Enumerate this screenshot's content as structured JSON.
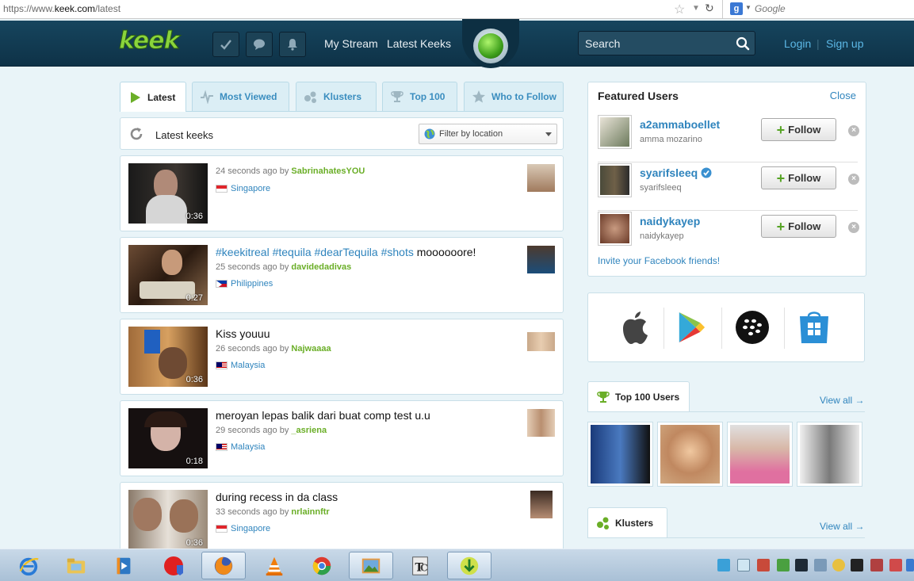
{
  "browser": {
    "url_prefix": "https://www.",
    "url_domain": "keek.com",
    "url_path": "/latest",
    "search_placeholder": "Google"
  },
  "header": {
    "logo": "keek",
    "nav": [
      "My Stream",
      "Latest Keeks"
    ],
    "search_placeholder": "Search",
    "login": "Login",
    "separator": "|",
    "signup": "Sign up"
  },
  "tabs": [
    {
      "label": "Latest",
      "icon": "play-icon",
      "active": true
    },
    {
      "label": "Most Viewed",
      "icon": "pulse-icon",
      "active": false
    },
    {
      "label": "Klusters",
      "icon": "klusters-icon",
      "active": false
    },
    {
      "label": "Top 100",
      "icon": "trophy-icon",
      "active": false
    },
    {
      "label": "Who to Follow",
      "icon": "star-icon",
      "active": false
    }
  ],
  "subbar": {
    "label": "Latest keeks",
    "filter_placeholder": "Filter by location"
  },
  "keeks": [
    {
      "caption_tags": "",
      "caption_text": "",
      "time": "24 seconds ago by",
      "user": "SabrinahatesYOU",
      "location": "Singapore",
      "flag": "sg",
      "duration": "0:36"
    },
    {
      "caption_tags": "#keekitreal #tequila #dearTequila #shots",
      "caption_text": " moooooore!",
      "time": "25 seconds ago by",
      "user": "davidedadivas",
      "location": "Philippines",
      "flag": "ph",
      "duration": "0:27"
    },
    {
      "caption_tags": "",
      "caption_text": "Kiss youuu",
      "time": "26 seconds ago by",
      "user": "Najwaaaa",
      "location": "Malaysia",
      "flag": "my",
      "duration": "0:36"
    },
    {
      "caption_tags": "",
      "caption_text": "meroyan lepas balik dari buat comp test u.u",
      "time": "29 seconds ago by",
      "user": "_asriena",
      "location": "Malaysia",
      "flag": "my",
      "duration": "0:18"
    },
    {
      "caption_tags": "",
      "caption_text": "during recess in da class",
      "time": "33 seconds ago by",
      "user": "nrlainnftr",
      "location": "Singapore",
      "flag": "sg",
      "duration": "0:36"
    }
  ],
  "featured": {
    "title": "Featured Users",
    "close": "Close",
    "follow_label": "Follow",
    "users": [
      {
        "username": "a2ammaboellet",
        "name": "amma mozarino",
        "verified": false
      },
      {
        "username": "syarifsleeq",
        "name": "syarifsleeq",
        "verified": true
      },
      {
        "username": "naidykayep",
        "name": "naidykayep",
        "verified": false
      }
    ],
    "invite": "Invite your Facebook friends!"
  },
  "apps": [
    "apple-icon",
    "google-play-icon",
    "blackberry-icon",
    "windows-store-icon"
  ],
  "top100": {
    "title": "Top 100 Users",
    "view_all": "View all →"
  },
  "klusters": {
    "title": "Klusters",
    "view_all": "View all →"
  },
  "colors": {
    "header": "#16455e",
    "accent_green": "#6aae27",
    "link_blue": "#2f84bd",
    "page_bg": "#e9f4f8"
  }
}
